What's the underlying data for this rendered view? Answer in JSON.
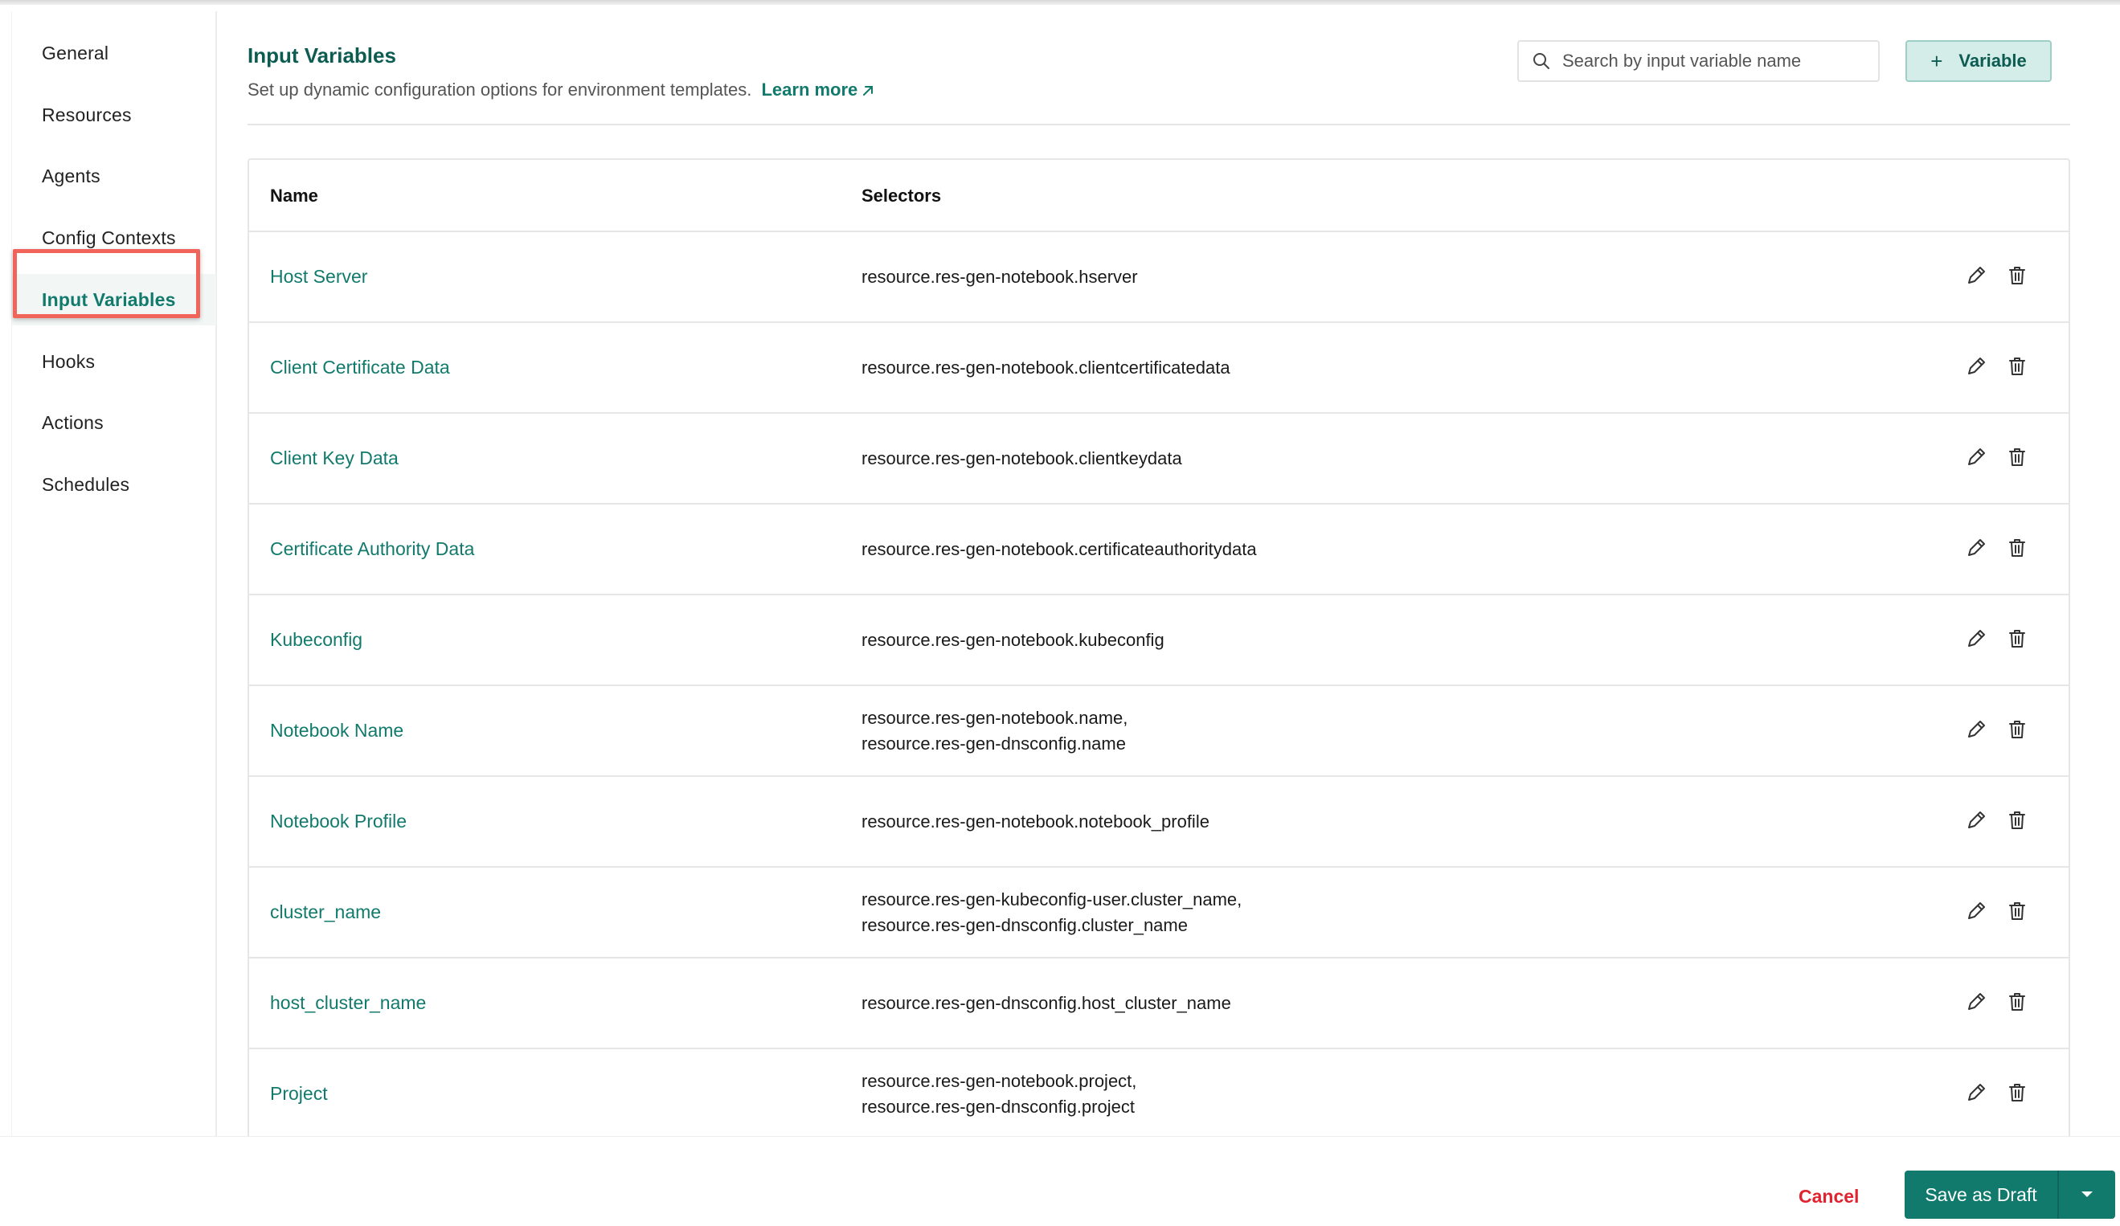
{
  "sidebar": {
    "items": [
      {
        "label": "General"
      },
      {
        "label": "Resources"
      },
      {
        "label": "Agents"
      },
      {
        "label": "Config Contexts"
      },
      {
        "label": "Input Variables"
      },
      {
        "label": "Hooks"
      },
      {
        "label": "Actions"
      },
      {
        "label": "Schedules"
      }
    ],
    "active": "Input Variables"
  },
  "header": {
    "title": "Input Variables",
    "subtitle": "Set up dynamic configuration options for environment templates.",
    "learn_more": "Learn more",
    "search_placeholder": "Search by input variable name",
    "add_label": "Variable"
  },
  "table": {
    "columns": {
      "name": "Name",
      "selectors": "Selectors"
    },
    "rows": [
      {
        "name": "Host Server",
        "selectors": [
          "resource.res-gen-notebook.hserver"
        ]
      },
      {
        "name": "Client Certificate Data",
        "selectors": [
          "resource.res-gen-notebook.clientcertificatedata"
        ]
      },
      {
        "name": "Client Key Data",
        "selectors": [
          "resource.res-gen-notebook.clientkeydata"
        ]
      },
      {
        "name": "Certificate Authority Data",
        "selectors": [
          "resource.res-gen-notebook.certificateauthoritydata"
        ]
      },
      {
        "name": "Kubeconfig",
        "selectors": [
          "resource.res-gen-notebook.kubeconfig"
        ]
      },
      {
        "name": "Notebook Name",
        "selectors": [
          "resource.res-gen-notebook.name,",
          "resource.res-gen-dnsconfig.name"
        ]
      },
      {
        "name": "Notebook Profile",
        "selectors": [
          "resource.res-gen-notebook.notebook_profile"
        ]
      },
      {
        "name": "cluster_name",
        "selectors": [
          "resource.res-gen-kubeconfig-user.cluster_name,",
          "resource.res-gen-dnsconfig.cluster_name"
        ]
      },
      {
        "name": "host_cluster_name",
        "selectors": [
          "resource.res-gen-dnsconfig.host_cluster_name"
        ]
      },
      {
        "name": "Project",
        "selectors": [
          "resource.res-gen-notebook.project,",
          "resource.res-gen-dnsconfig.project"
        ]
      }
    ]
  },
  "footer": {
    "cancel_label": "Cancel",
    "save_label": "Save as Draft"
  },
  "colors": {
    "accent": "#127a6c",
    "title": "#0c5c52",
    "danger": "#e0232e",
    "highlight": "#f0645a"
  }
}
